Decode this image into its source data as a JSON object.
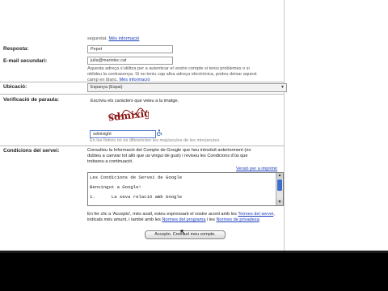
{
  "top_note": {
    "text": "seguretat.",
    "link": "Més informació"
  },
  "answer": {
    "label": "Resposta:",
    "value": "Pepet"
  },
  "secondary_email": {
    "label": "E-mail secundari:",
    "value": "julia@mariotec.cat",
    "help": [
      "Aquesta adreça s'utilitza per a autenticar el vostre compte si teniu problemes o si",
      "oblideu la contrasenya. Si no teniu cap altra adreça electrònica, podeu deixar aquest"
    ],
    "help_tail": "camp en blanc.",
    "help_link": "Més informació"
  },
  "location": {
    "label": "Ubicació:",
    "value": "Espanya (Espai)"
  },
  "word_verification": {
    "label": "Verificació de paraula:",
    "instruction": "Escriviu els caràcters que veieu a la imatge.",
    "captcha_text": "sdmixigh",
    "input_value": "sdmixight",
    "note": "En les lletres no es diferencien les majúscules de les minúscules"
  },
  "terms": {
    "label": "Condicions del servei:",
    "intro": [
      "Consulteu la Informació del Compte de Google que heu introduït anteriorment (no",
      "dubteu a canviar tot allò que us vingui de gust) i reviseu les Condicions d'ús que",
      "trobareu a continuació."
    ],
    "printable_link": "Versió per a imprimir",
    "box_lines": [
      "Les Condicions de Servei de Google",
      "Benvingut a Google!",
      "1.      La seva relació amb Google"
    ],
    "accept_text_1": "En fer clic a 'Accepto', més avall, esteu expressant el vostre acord amb les ",
    "link_terms": "Termes del servei",
    "accept_text_2": ", indicats més amunt, i també amb les ",
    "link_program": "Normes del programa",
    "accept_text_3": " i les ",
    "link_privacy": "Normes de privadesa",
    "accept_text_4": ".",
    "button": "Accepto. Creeu el meu compte."
  }
}
